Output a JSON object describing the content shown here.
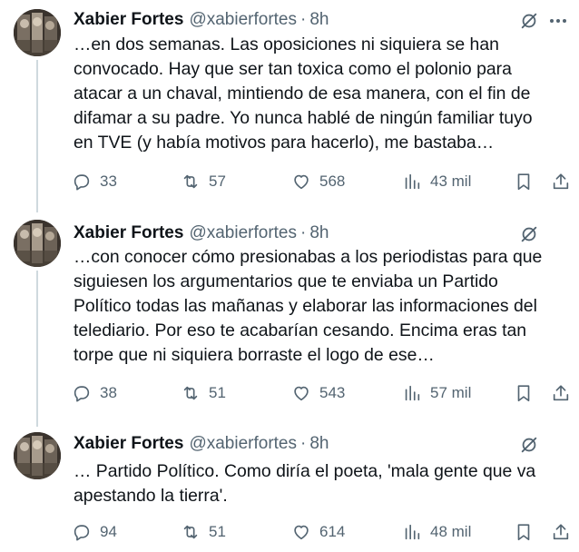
{
  "tweets": [
    {
      "author": "Xabier Fortes",
      "handle": "@xabierfortes",
      "separator": "·",
      "time": "8h",
      "lines": [
        "…en dos semanas. Las oposiciones ni siquiera se han",
        "convocado. Hay que ser tan toxica como el polonio para",
        "atacar a un chaval, mintiendo de esa manera, con el fin de",
        "difamar a su padre. Yo nunca hablé de ningún familiar tuyo",
        "en TVE (y había motivos para hacerlo), me bastaba…"
      ],
      "replies": "33",
      "retweets": "57",
      "likes": "568",
      "views": "43 mil"
    },
    {
      "author": "Xabier Fortes",
      "handle": "@xabierfortes",
      "separator": "·",
      "time": "8h",
      "lines": [
        "…con conocer cómo presionabas a los periodistas para que",
        "siguiesen los argumentarios que te enviaba un Partido",
        "Político todas las mañanas y elaborar las informaciones del",
        "telediario. Por eso te acabarían cesando. Encima eras tan",
        "torpe que ni siquiera borraste el logo de ese…"
      ],
      "replies": "38",
      "retweets": "51",
      "likes": "543",
      "views": "57 mil"
    },
    {
      "author": "Xabier Fortes",
      "handle": "@xabierfortes",
      "separator": "·",
      "time": "8h",
      "lines": [
        "… Partido Político. Como diría el poeta, 'mala gente que va",
        "apestando la tierra'."
      ],
      "replies": "94",
      "retweets": "51",
      "likes": "614",
      "views": "48 mil"
    }
  ],
  "icons": {
    "reply": "reply-icon",
    "retweet": "retweet-icon",
    "like": "heart-icon",
    "views": "views-icon",
    "bookmark": "bookmark-icon",
    "share": "share-icon",
    "grok": "grok-icon",
    "more": "more-icon"
  },
  "colors": {
    "text": "#0f1419",
    "secondary": "#536471",
    "thread_line": "#cfd9de"
  }
}
